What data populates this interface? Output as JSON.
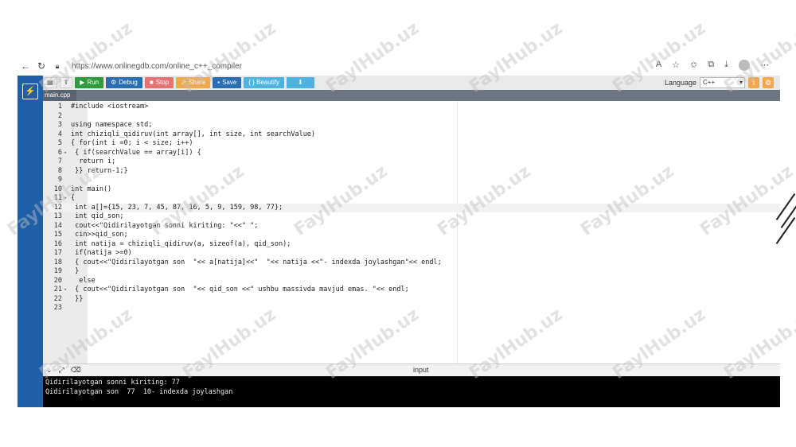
{
  "browser": {
    "url": "https://www.onlinegdb.com/online_c++_compiler",
    "back_icon": "back-arrow-icon",
    "reload_icon": "reload-icon"
  },
  "toolbar": {
    "run_label": "Run",
    "debug_label": "Debug",
    "stop_label": "Stop",
    "share_label": "Share",
    "save_label": "Save",
    "beautify_label": "{ } Beautify",
    "language_label": "Language",
    "language_value": "C++"
  },
  "tab": {
    "filename": "main.cpp"
  },
  "code": [
    {
      "n": "1",
      "fold": "",
      "text": "#include <iostream>"
    },
    {
      "n": "2",
      "fold": "",
      "text": ""
    },
    {
      "n": "3",
      "fold": "",
      "text": "using namespace std;"
    },
    {
      "n": "4",
      "fold": "",
      "text": "int chiziqli_qidiruv(int array[], int size, int searchValue)"
    },
    {
      "n": "5",
      "fold": "",
      "text": "{ for(int i =0; i < size; i++)"
    },
    {
      "n": "6",
      "fold": "▾",
      "text": " { if(searchValue == array[i]) {"
    },
    {
      "n": "7",
      "fold": "",
      "text": "  return i;"
    },
    {
      "n": "8",
      "fold": "",
      "text": " }} return-1;}"
    },
    {
      "n": "9",
      "fold": "",
      "text": ""
    },
    {
      "n": "10",
      "fold": "",
      "text": "int main()"
    },
    {
      "n": "11",
      "fold": "▾",
      "text": "{"
    },
    {
      "n": "12",
      "fold": "",
      "text": " int a[]={15, 23, 7, 45, 87, 16, 5, 9, 159, 98, 77};"
    },
    {
      "n": "13",
      "fold": "",
      "text": " int qid_son;"
    },
    {
      "n": "14",
      "fold": "",
      "text": " cout<<\"Qidirilayotgan sonni kiriting: \"<<\" \";"
    },
    {
      "n": "15",
      "fold": "",
      "text": " cin>>qid_son;"
    },
    {
      "n": "16",
      "fold": "",
      "text": " int natija = chiziqli_qidiruv(a, sizeof(a), qid_son);"
    },
    {
      "n": "17",
      "fold": "",
      "text": " if(natija >=0)"
    },
    {
      "n": "18",
      "fold": "",
      "text": " { cout<<\"Qidirilayotgan son  \"<< a[natija]<<\"  \"<< natija <<\"- indexda joylashgan\"<< endl;"
    },
    {
      "n": "19",
      "fold": "",
      "text": " }"
    },
    {
      "n": "20",
      "fold": "",
      "text": "  else"
    },
    {
      "n": "21",
      "fold": "▾",
      "text": " { cout<<\"Qidirilayotgan son  \"<< qid_son <<\" ushbu massivda mavjud emas. \"<< endl;"
    },
    {
      "n": "22",
      "fold": "",
      "text": " }}"
    },
    {
      "n": "23",
      "fold": "",
      "text": ""
    }
  ],
  "io": {
    "input_label": "input"
  },
  "terminal": [
    "Qidirilayotgan sonni kiriting: 77",
    "Qidirilayotgan son  77  10- indexda joylashgan"
  ],
  "watermark_text": "FaylHub.uz"
}
